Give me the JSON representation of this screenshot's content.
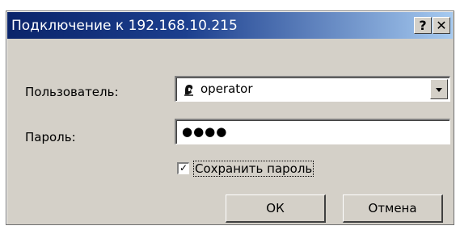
{
  "window": {
    "title": "Подключение к 192.168.10.215",
    "help_label": "?",
    "close_label": "✕"
  },
  "form": {
    "user_label": "Пользователь:",
    "user_value": "operator",
    "user_icon": "user-icon",
    "password_label": "Пароль:",
    "password_value": "●●●●",
    "save_password_label": "Сохранить пароль",
    "save_password_checked": true,
    "save_password_mark": "✓"
  },
  "buttons": {
    "ok_label": "ОК",
    "cancel_label": "Отмена"
  }
}
